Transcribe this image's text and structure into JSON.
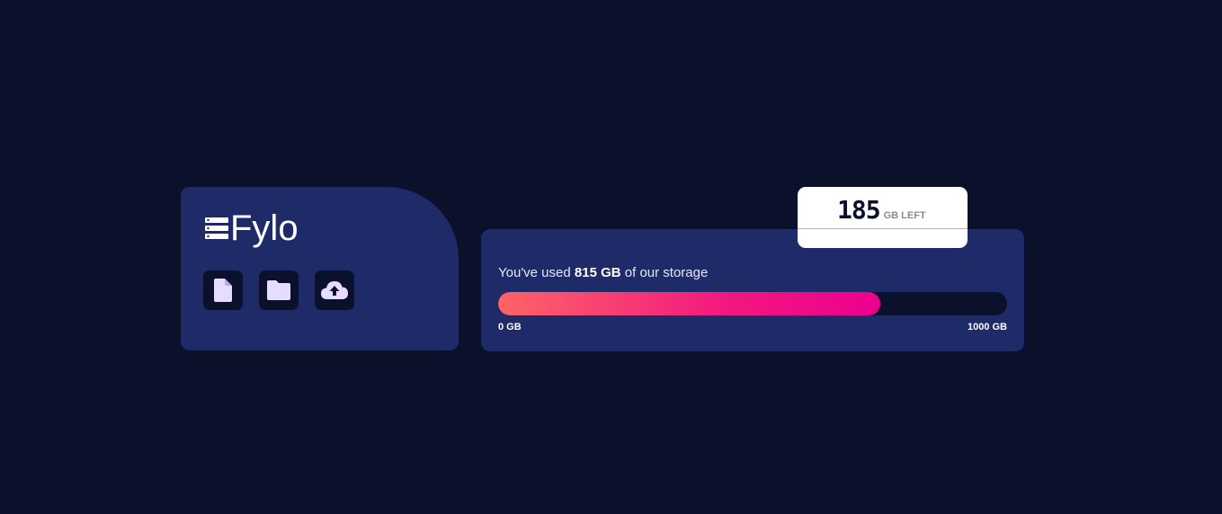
{
  "brand": {
    "name": "Fylo",
    "logo_icon": "server-stack-icon"
  },
  "tools": [
    {
      "name": "file-icon",
      "label": "Upload document"
    },
    {
      "name": "folder-icon",
      "label": "Upload folder"
    },
    {
      "name": "cloud-upload-icon",
      "label": "Upload to cloud"
    }
  ],
  "storage": {
    "prefix": "You've used ",
    "used_label": "815 GB",
    "suffix": " of our storage",
    "used_gb": 815,
    "total_gb": 1000,
    "min_label": "0 GB",
    "max_label": "1000 GB"
  },
  "callout": {
    "remaining": "185",
    "unit": "GB LEFT"
  },
  "colors": {
    "background": "#0c112b",
    "card": "#1f2a68",
    "gradient_start": "#fe6468",
    "gradient_end": "#ec0090",
    "icon": "#e6dcff"
  }
}
